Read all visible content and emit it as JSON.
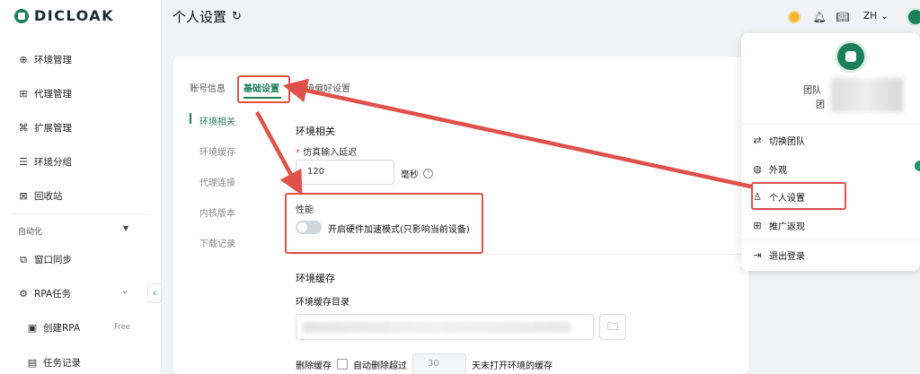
{
  "sidebar": {
    "logo": "DICLOAK",
    "items": [
      {
        "label": "环境管理",
        "icon": "globe-icon"
      },
      {
        "label": "代理管理",
        "icon": "proxy-icon"
      },
      {
        "label": "扩展管理",
        "icon": "extension-icon"
      },
      {
        "label": "环境分组",
        "icon": "group-icon"
      },
      {
        "label": "回收站",
        "icon": "trash-icon"
      }
    ],
    "automation_label": "自动化",
    "auto_items": [
      {
        "label": "窗口同步",
        "icon": "sync-icon"
      },
      {
        "label": "RPA任务",
        "icon": "robot-icon"
      }
    ],
    "sub_items": [
      {
        "label": "创建RPA",
        "badge": "Free",
        "icon": "create-icon"
      },
      {
        "label": "任务记录",
        "icon": "record-icon"
      }
    ]
  },
  "header": {
    "title": "个人设置",
    "lang": "ZH"
  },
  "tabs": [
    {
      "label": "账号信息",
      "active": false
    },
    {
      "label": "基础设置",
      "active": true
    },
    {
      "label": "环境偏好设置",
      "active": false
    }
  ],
  "side_nav": [
    "环境相关",
    "环境缓存",
    "代理连接",
    "内核版本",
    "下载记录"
  ],
  "env": {
    "section_title": "环境相关",
    "delay_label": "仿真输入延迟",
    "delay_value": "120",
    "delay_unit": "毫秒",
    "perf_label": "性能",
    "hw_accel_label": "开启硬件加速模式(只影响当前设备)",
    "hw_accel_on": false
  },
  "cache": {
    "section_title": "环境缓存",
    "dir_label": "环境缓存目录",
    "delete_label": "删除缓存",
    "auto_delete_label": "自动删除超过",
    "days": "30",
    "days_suffix": "天未打开环境的缓存"
  },
  "dropdown": {
    "team_line1": "团队",
    "team_line2": "团",
    "items": [
      {
        "label": "切换团队",
        "icon": "switch-team-icon"
      },
      {
        "label": "外观",
        "icon": "appearance-icon"
      },
      {
        "label": "个人设置",
        "icon": "user-icon"
      },
      {
        "label": "推广返现",
        "icon": "gift-icon"
      },
      {
        "label": "退出登录",
        "icon": "logout-icon"
      }
    ]
  },
  "colors": {
    "accent": "#1b7f5b",
    "annotation": "#e0514a"
  }
}
